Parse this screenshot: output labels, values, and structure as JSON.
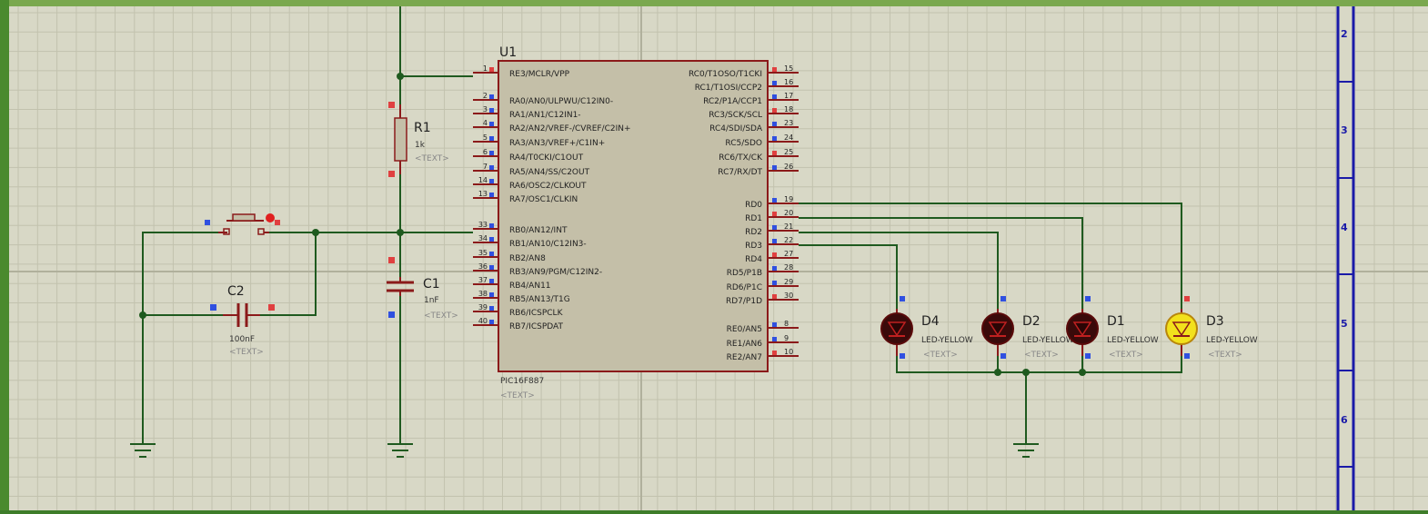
{
  "sheet": {
    "border_labels": [
      "2",
      "3",
      "4",
      "5",
      "6"
    ],
    "colors": {
      "background": "#d8d8c6",
      "grid": "#c2c2ae",
      "wire": "#1f5a1f",
      "body": "#c4bfa8",
      "body_border": "#8b1a1a",
      "border": "#1a1aa8"
    }
  },
  "components": {
    "u1": {
      "ref": "U1",
      "part": "PIC16F887",
      "text": "<TEXT>",
      "left_pins": [
        {
          "num": "1",
          "name": "RE3/MCLR/VPP"
        },
        {
          "num": "2",
          "name": "RA0/AN0/ULPWU/C12IN0-"
        },
        {
          "num": "3",
          "name": "RA1/AN1/C12IN1-"
        },
        {
          "num": "4",
          "name": "RA2/AN2/VREF-/CVREF/C2IN+"
        },
        {
          "num": "5",
          "name": "RA3/AN3/VREF+/C1IN+"
        },
        {
          "num": "6",
          "name": "RA4/T0CKI/C1OUT"
        },
        {
          "num": "7",
          "name": "RA5/AN4/SS/C2OUT"
        },
        {
          "num": "14",
          "name": "RA6/OSC2/CLKOUT"
        },
        {
          "num": "13",
          "name": "RA7/OSC1/CLKIN"
        },
        {
          "num": "33",
          "name": "RB0/AN12/INT"
        },
        {
          "num": "34",
          "name": "RB1/AN10/C12IN3-"
        },
        {
          "num": "35",
          "name": "RB2/AN8"
        },
        {
          "num": "36",
          "name": "RB3/AN9/PGM/C12IN2-"
        },
        {
          "num": "37",
          "name": "RB4/AN11"
        },
        {
          "num": "38",
          "name": "RB5/AN13/T1G"
        },
        {
          "num": "39",
          "name": "RB6/ICSPCLK"
        },
        {
          "num": "40",
          "name": "RB7/ICSPDAT"
        }
      ],
      "right_pins": [
        {
          "num": "15",
          "name": "RC0/T1OSO/T1CKI"
        },
        {
          "num": "16",
          "name": "RC1/T1OSI/CCP2"
        },
        {
          "num": "17",
          "name": "RC2/P1A/CCP1"
        },
        {
          "num": "18",
          "name": "RC3/SCK/SCL"
        },
        {
          "num": "23",
          "name": "RC4/SDI/SDA"
        },
        {
          "num": "24",
          "name": "RC5/SDO"
        },
        {
          "num": "25",
          "name": "RC6/TX/CK"
        },
        {
          "num": "26",
          "name": "RC7/RX/DT"
        },
        {
          "num": "19",
          "name": "RD0"
        },
        {
          "num": "20",
          "name": "RD1"
        },
        {
          "num": "21",
          "name": "RD2"
        },
        {
          "num": "22",
          "name": "RD3"
        },
        {
          "num": "27",
          "name": "RD4"
        },
        {
          "num": "28",
          "name": "RD5/P1B"
        },
        {
          "num": "29",
          "name": "RD6/P1C"
        },
        {
          "num": "30",
          "name": "RD7/P1D"
        },
        {
          "num": "8",
          "name": "RE0/AN5"
        },
        {
          "num": "9",
          "name": "RE1/AN6"
        },
        {
          "num": "10",
          "name": "RE2/AN7"
        }
      ]
    },
    "r1": {
      "ref": "R1",
      "value": "1k",
      "text": "<TEXT>"
    },
    "c1": {
      "ref": "C1",
      "value": "1nF",
      "text": "<TEXT>"
    },
    "c2": {
      "ref": "C2",
      "value": "100nF",
      "text": "<TEXT>"
    },
    "leds": [
      {
        "ref": "D4",
        "value": "LED-YELLOW",
        "text": "<TEXT>",
        "lit": false
      },
      {
        "ref": "D2",
        "value": "LED-YELLOW",
        "text": "<TEXT>",
        "lit": false
      },
      {
        "ref": "D1",
        "value": "LED-YELLOW",
        "text": "<TEXT>",
        "lit": false
      },
      {
        "ref": "D3",
        "value": "LED-YELLOW",
        "text": "<TEXT>",
        "lit": true
      }
    ]
  }
}
